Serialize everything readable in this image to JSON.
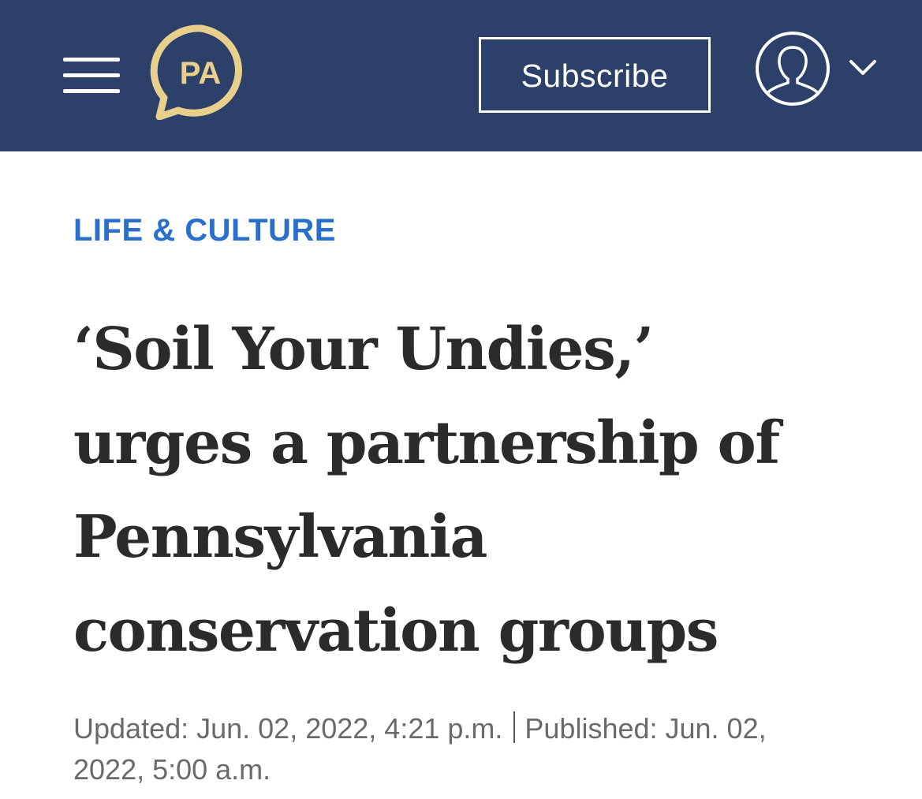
{
  "header": {
    "menu_icon": "hamburger-menu-icon",
    "logo": {
      "text": "PA",
      "colors": {
        "ring": "#e9cf8c",
        "background": "#2c4069",
        "text": "#e9cf8c"
      }
    },
    "subscribe_label": "Subscribe",
    "account_icon": "user-avatar-icon",
    "dropdown_icon": "chevron-down-icon",
    "background_color": "#2c4069"
  },
  "article": {
    "section": "LIFE & CULTURE",
    "section_color": "#2a6fc9",
    "headline_lines": [
      "‘Soil Your Undies,’",
      "urges a partnership of",
      "Pennsylvania",
      "conservation groups"
    ],
    "updated": "Updated: Jun. 02, 2022, 4:21 p.m.",
    "published_line1": "Published: Jun. 02,",
    "published_line2": "2022, 5:00 a.m."
  }
}
